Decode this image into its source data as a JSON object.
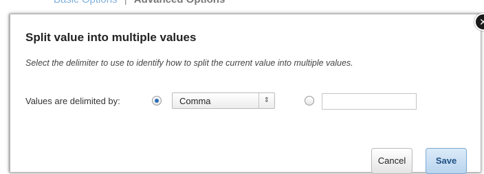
{
  "background": {
    "tab_basic": "Basic Options",
    "separator": "|",
    "tab_advanced": "Advanced Options"
  },
  "dialog": {
    "close_icon": "close-icon",
    "close_glyph": "✕",
    "title": "Split value into multiple values",
    "description": "Select the delimiter to use to identify how to split the current value into multiple values.",
    "delimiter_label": "Values are delimited by:",
    "delimiter_options": {
      "selected_value": "Comma",
      "selected_radio": "preset"
    },
    "custom_delimiter_value": "",
    "cancel_label": "Cancel",
    "save_label": "Save"
  },
  "colors": {
    "accent": "#2d6fb5",
    "save_button": "#c9def2",
    "link": "#7fb0dc"
  }
}
